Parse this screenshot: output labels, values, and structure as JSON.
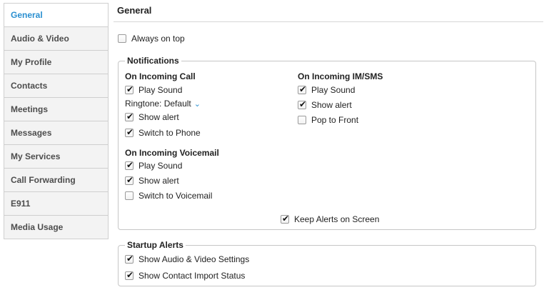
{
  "sidebar": {
    "items": [
      {
        "label": "General"
      },
      {
        "label": "Audio & Video"
      },
      {
        "label": "My Profile"
      },
      {
        "label": "Contacts"
      },
      {
        "label": "Meetings"
      },
      {
        "label": "Messages"
      },
      {
        "label": "My Services"
      },
      {
        "label": "Call Forwarding"
      },
      {
        "label": "E911"
      },
      {
        "label": "Media Usage"
      }
    ],
    "active": "General"
  },
  "main": {
    "title": "General",
    "always_on_top": {
      "label": "Always on top",
      "checked": false
    }
  },
  "notifications": {
    "legend": "Notifications",
    "incoming_call": {
      "heading": "On Incoming Call",
      "play_sound": {
        "label": "Play Sound",
        "checked": true
      },
      "ringtone": {
        "label": "Ringtone:",
        "value": "Default"
      },
      "show_alert": {
        "label": "Show alert",
        "checked": true
      },
      "switch_to_phone": {
        "label": "Switch to Phone",
        "checked": true
      }
    },
    "incoming_voicemail": {
      "heading": "On Incoming Voicemail",
      "play_sound": {
        "label": "Play Sound",
        "checked": true
      },
      "show_alert": {
        "label": "Show alert",
        "checked": true
      },
      "switch_to_voicemail": {
        "label": "Switch to Voicemail",
        "checked": false
      }
    },
    "incoming_im": {
      "heading": "On Incoming IM/SMS",
      "play_sound": {
        "label": "Play Sound",
        "checked": true
      },
      "show_alert": {
        "label": "Show alert",
        "checked": true
      },
      "pop_to_front": {
        "label": "Pop to Front",
        "checked": false
      }
    },
    "keep_alerts": {
      "label": "Keep Alerts on Screen",
      "checked": true
    }
  },
  "startup_alerts": {
    "legend": "Startup Alerts",
    "show_av_settings": {
      "label": "Show Audio & Video Settings",
      "checked": true
    },
    "show_contact_import": {
      "label": "Show Contact Import Status",
      "checked": true
    }
  },
  "colors": {
    "accent": "#2a8fd0",
    "sidebar_bg": "#f3f3f3",
    "border": "#cfcfcf"
  },
  "icons": {
    "checkmark": "check-icon",
    "ringtone_dropdown": "chevron-down-icon"
  }
}
